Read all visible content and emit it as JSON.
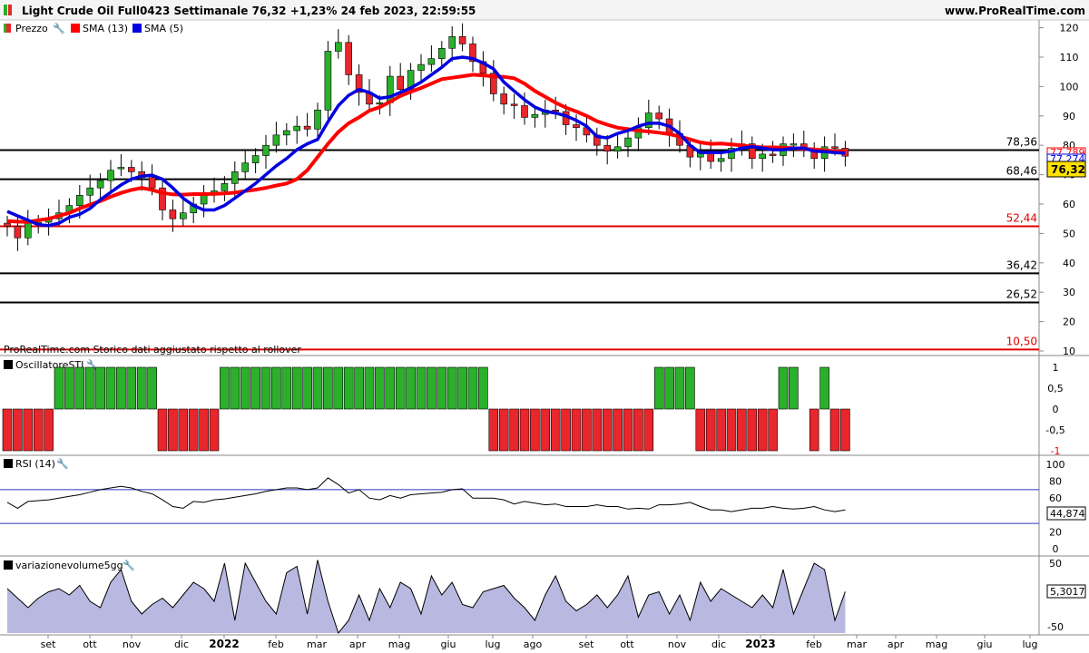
{
  "header": {
    "title": "Light Crude Oil Full0423 Settimanale 76,32 +1,23% 24 feb 2023, 22:59:55",
    "site": "www.ProRealTime.com"
  },
  "legend": {
    "price": "Prezzo",
    "sma13": "SMA (13)",
    "sma5": "SMA (5)"
  },
  "notes": {
    "history": "ProRealTime.com Storico dati aggiustato rispetto al rollover"
  },
  "levels": [
    {
      "value": 78.36,
      "label": "78,36",
      "color": "#000000"
    },
    {
      "value": 68.46,
      "label": "68,46",
      "color": "#000000"
    },
    {
      "value": 52.44,
      "label": "52,44",
      "color": "#e00000"
    },
    {
      "value": 36.42,
      "label": "36,42",
      "color": "#000000"
    },
    {
      "value": 26.52,
      "label": "26,52",
      "color": "#000000"
    },
    {
      "value": 10.5,
      "label": "10,50",
      "color": "#e00000"
    }
  ],
  "price_badges": {
    "sma13": "77,789",
    "sma5": "77,274",
    "last": "76,32"
  },
  "panels": {
    "sti": {
      "title": "OscillatoreSTI",
      "ticks": [
        "1",
        "0,5",
        "0",
        "-0,5",
        "-1"
      ]
    },
    "rsi": {
      "title": "RSI (14)",
      "ticks": [
        "100",
        "80",
        "60",
        "40",
        "20",
        "0"
      ],
      "value": "44,874"
    },
    "vol": {
      "title": "variazionevolume5gg",
      "ticks": [
        "50",
        "-50"
      ],
      "value": "5,3017"
    }
  },
  "colors": {
    "up": "#2bb02b",
    "down": "#e8262b",
    "sma13": "#ff0000",
    "sma5": "#0000e0",
    "volume_fill": "#b8b8e0"
  },
  "chart_data": [
    {
      "type": "candlestick",
      "title": "Light Crude Oil Full0423 Settimanale",
      "x_tick_labels": [
        "set",
        "ott",
        "nov",
        "dic",
        "2022",
        "feb",
        "mar",
        "apr",
        "mag",
        "giu",
        "lug",
        "ago",
        "set",
        "ott",
        "nov",
        "dic",
        "2023",
        "feb",
        "mar",
        "apr",
        "mag",
        "giu",
        "lug"
      ],
      "y_ticks": [
        10,
        20,
        30,
        40,
        50,
        60,
        70,
        80,
        90,
        100,
        110,
        120
      ],
      "ylim": [
        8,
        125
      ],
      "close": [
        52.5,
        48.5,
        53.5,
        53.8,
        55.0,
        57.0,
        59.5,
        63.0,
        65.5,
        68.0,
        71.5,
        72.5,
        71.0,
        69.0,
        65.5,
        58.0,
        55.0,
        57.0,
        60.0,
        63.0,
        64.5,
        67.0,
        71.0,
        74.0,
        76.5,
        80.0,
        83.5,
        85.0,
        86.5,
        85.5,
        92.0,
        112.0,
        115.0,
        104.0,
        98.0,
        94.0,
        94.5,
        103.5,
        99.0,
        105.5,
        107.5,
        109.5,
        113.0,
        117.0,
        114.5,
        108.5,
        104.5,
        97.5,
        94.0,
        93.5,
        89.5,
        90.5,
        92.0,
        91.5,
        87.0,
        86.0,
        83.5,
        80.0,
        78.0,
        79.5,
        82.5,
        86.0,
        91.0,
        89.0,
        84.0,
        80.0,
        76.0,
        77.5,
        74.5,
        75.5,
        79.0,
        80.5,
        75.5,
        77.0,
        76.5,
        80.5,
        80.5,
        78.5,
        75.5,
        79.5,
        79.0,
        76.3
      ],
      "open": [
        53.5,
        52.5,
        48.5,
        53.5,
        53.8,
        55.0,
        57.0,
        59.5,
        63.0,
        65.5,
        68.0,
        72.0,
        72.5,
        71.0,
        69.0,
        65.5,
        58.0,
        55.0,
        57.0,
        60.0,
        63.0,
        64.5,
        67.0,
        71.0,
        74.0,
        76.5,
        80.0,
        83.5,
        85.0,
        86.5,
        85.5,
        92.0,
        112.0,
        115.0,
        104.0,
        98.0,
        94.0,
        94.5,
        103.5,
        99.0,
        105.5,
        107.5,
        109.5,
        113.0,
        117.0,
        114.5,
        108.5,
        104.5,
        97.5,
        94.0,
        93.5,
        89.5,
        90.5,
        92.0,
        91.5,
        87.0,
        86.0,
        83.5,
        80.0,
        78.0,
        79.5,
        82.5,
        86.0,
        91.0,
        89.0,
        84.0,
        80.0,
        76.0,
        77.5,
        74.5,
        75.5,
        79.0,
        80.5,
        75.5,
        77.0,
        76.5,
        80.5,
        80.5,
        78.5,
        75.5,
        79.5,
        79.0
      ],
      "sma13": [
        54.2,
        54.0,
        53.9,
        54.5,
        55.0,
        56.0,
        57.0,
        58.5,
        59.8,
        61.0,
        62.5,
        63.8,
        64.8,
        65.5,
        64.8,
        63.8,
        63.3,
        63.2,
        63.4,
        63.4,
        63.5,
        63.6,
        63.9,
        64.4,
        64.9,
        65.5,
        66.3,
        67.0,
        68.5,
        71.5,
        76.0,
        80.5,
        84.5,
        87.5,
        89.5,
        91.8,
        93.0,
        94.8,
        96.8,
        98.2,
        99.5,
        101.0,
        102.5,
        103.0,
        103.5,
        104.0,
        103.8,
        103.5,
        103.3,
        102.8,
        101.0,
        98.5,
        96.5,
        94.5,
        92.8,
        91.5,
        90.0,
        88.2,
        87.0,
        86.0,
        85.5,
        85.0,
        84.7,
        84.3,
        83.8,
        83.0,
        82.0,
        81.0,
        80.5,
        80.6,
        80.3,
        80.0,
        79.5,
        79.3,
        79.3,
        79.2,
        79.0,
        78.8,
        78.6,
        78.3,
        78.0,
        77.8
      ],
      "sma5": [
        57.5,
        56.0,
        54.5,
        53.0,
        52.7,
        53.5,
        55.5,
        56.5,
        58.5,
        61.5,
        64.0,
        66.5,
        68.5,
        69.5,
        69.8,
        68.5,
        65.5,
        62.0,
        59.5,
        58.0,
        58.0,
        59.5,
        62.0,
        64.5,
        67.0,
        70.0,
        73.0,
        75.5,
        78.5,
        80.5,
        82.0,
        88.0,
        93.5,
        97.0,
        99.0,
        98.0,
        96.0,
        96.5,
        98.0,
        99.5,
        101.5,
        104.0,
        106.5,
        109.5,
        110.0,
        109.5,
        108.0,
        106.0,
        101.5,
        98.5,
        95.5,
        93.0,
        91.5,
        91.0,
        90.0,
        88.5,
        86.5,
        83.0,
        82.5,
        84.0,
        85.0,
        86.5,
        87.5,
        87.5,
        86.5,
        84.0,
        80.0,
        77.5,
        77.5,
        77.5,
        78.0,
        79.0,
        79.5,
        79.0,
        78.5,
        78.5,
        79.0,
        79.0,
        78.0,
        77.8,
        77.5,
        77.3
      ]
    },
    {
      "type": "bar",
      "title": "OscillatoreSTI",
      "ylim": [
        -1,
        1
      ],
      "values": [
        -1,
        -1,
        -1,
        -1,
        -1,
        1,
        1,
        1,
        1,
        1,
        1,
        1,
        1,
        1,
        1,
        -1,
        -1,
        -1,
        -1,
        -1,
        -1,
        1,
        1,
        1,
        1,
        1,
        1,
        1,
        1,
        1,
        1,
        1,
        1,
        1,
        1,
        1,
        1,
        1,
        1,
        1,
        1,
        1,
        1,
        1,
        1,
        1,
        1,
        -1,
        -1,
        -1,
        -1,
        -1,
        -1,
        -1,
        -1,
        -1,
        -1,
        -1,
        -1,
        -1,
        -1,
        -1,
        -1,
        1,
        1,
        1,
        1,
        -1,
        -1,
        -1,
        -1,
        -1,
        -1,
        -1,
        -1,
        1,
        1,
        0,
        -1,
        1,
        -1,
        -1
      ]
    },
    {
      "type": "line",
      "title": "RSI (14)",
      "ylim": [
        0,
        100
      ],
      "bands": [
        70,
        30
      ],
      "values": [
        55,
        48,
        56,
        57,
        58,
        60,
        62,
        64,
        67,
        70,
        72,
        74,
        72,
        68,
        65,
        58,
        50,
        48,
        56,
        55,
        58,
        59,
        61,
        63,
        65,
        68,
        70,
        72,
        72,
        70,
        72,
        84,
        76,
        66,
        70,
        60,
        58,
        63,
        60,
        64,
        65,
        66,
        67,
        70,
        71,
        60,
        60,
        60,
        58,
        53,
        56,
        54,
        52,
        53,
        50,
        50,
        50,
        52,
        50,
        50,
        47,
        48,
        47,
        52,
        52,
        53,
        55,
        50,
        46,
        46,
        44,
        46,
        48,
        48,
        50,
        48,
        47,
        48,
        50,
        46,
        44,
        46
      ]
    },
    {
      "type": "area",
      "title": "variazionevolume5gg",
      "ylim": [
        -60,
        60
      ],
      "values": [
        10,
        -5,
        -20,
        -5,
        5,
        10,
        0,
        15,
        -10,
        -20,
        20,
        40,
        -10,
        -30,
        -15,
        -5,
        -20,
        0,
        20,
        10,
        -10,
        50,
        -40,
        50,
        20,
        -10,
        -30,
        35,
        45,
        -30,
        55,
        -10,
        -60,
        -40,
        0,
        -40,
        10,
        -20,
        20,
        10,
        -30,
        30,
        0,
        20,
        -15,
        -20,
        5,
        10,
        15,
        -5,
        -20,
        -40,
        0,
        30,
        -10,
        -25,
        -15,
        0,
        -20,
        0,
        30,
        -35,
        0,
        5,
        -30,
        0,
        -40,
        20,
        -10,
        10,
        0,
        -10,
        -20,
        0,
        -20,
        40,
        -30,
        10,
        50,
        40,
        -40,
        5.3
      ]
    }
  ]
}
